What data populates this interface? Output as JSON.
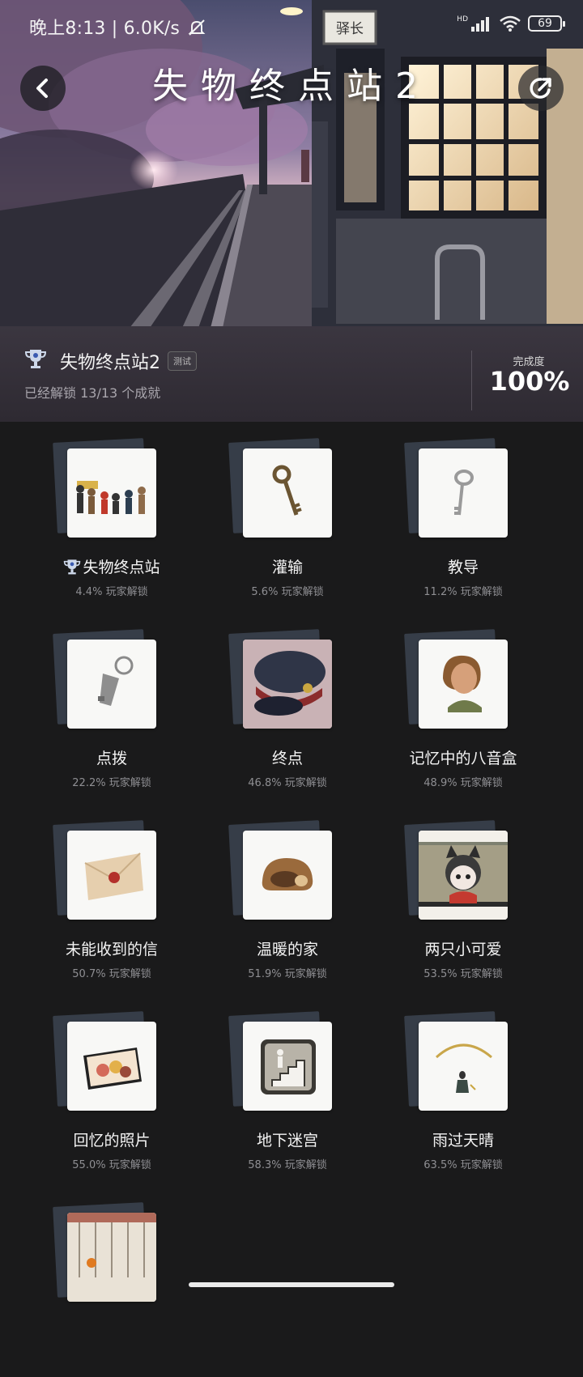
{
  "status_bar": {
    "time_text": "晚上8:13 | 6.0K/s",
    "mute_icon": "bell-off-icon",
    "signal_badge": "HD",
    "battery_level": "69"
  },
  "header": {
    "title": "失物终点站2",
    "sign_text": "驿长"
  },
  "game_info": {
    "name": "失物终点站2",
    "tag": "测试",
    "unlock_summary": "已经解锁 13/13 个成就",
    "completion_label": "完成度",
    "completion_value": "100%"
  },
  "achievements": [
    {
      "title": "失物终点站",
      "rate": "4.4% 玩家解锁",
      "icon": "group-of-people"
    },
    {
      "title": "灌输",
      "rate": "5.6% 玩家解锁",
      "icon": "old-key"
    },
    {
      "title": "教导",
      "rate": "11.2% 玩家解锁",
      "icon": "skeleton-key"
    },
    {
      "title": "点拨",
      "rate": "22.2% 玩家解锁",
      "icon": "keychain-key"
    },
    {
      "title": "终点",
      "rate": "46.8% 玩家解锁",
      "icon": "conductor-hat"
    },
    {
      "title": "记忆中的八音盒",
      "rate": "48.9% 玩家解锁",
      "icon": "woman-portrait"
    },
    {
      "title": "未能收到的信",
      "rate": "50.7% 玩家解锁",
      "icon": "sealed-letter"
    },
    {
      "title": "温暖的家",
      "rate": "51.9% 玩家解锁",
      "icon": "cozy-den"
    },
    {
      "title": "两只小可爱",
      "rate": "53.5% 玩家解锁",
      "icon": "cat-girl"
    },
    {
      "title": "回忆的照片",
      "rate": "55.0% 玩家解锁",
      "icon": "photo"
    },
    {
      "title": "地下迷宫",
      "rate": "58.3% 玩家解锁",
      "icon": "stairs-sign"
    },
    {
      "title": "雨过天晴",
      "rate": "63.5% 玩家解锁",
      "icon": "rainbow-girl"
    },
    {
      "title": "",
      "rate": "",
      "icon": "partial-card"
    }
  ]
}
